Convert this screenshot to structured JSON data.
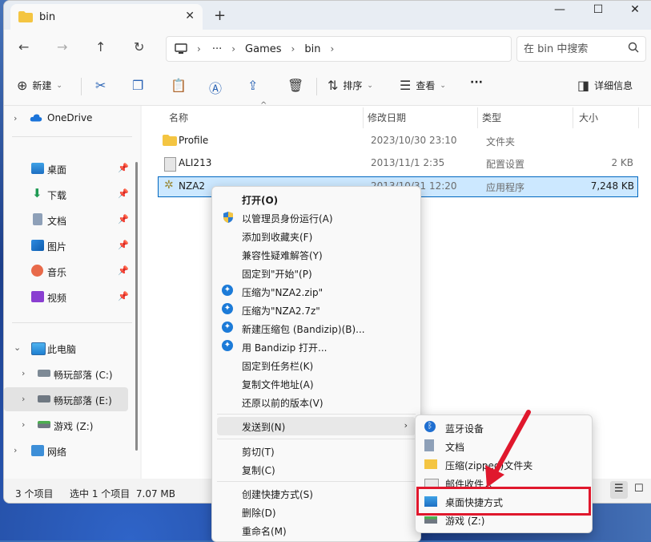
{
  "colors": {
    "accent": "#0067c0",
    "folder": "#f4c542",
    "highlight": "#e0182d",
    "selected_row": "#cce8ff"
  },
  "window": {
    "tab_title": "bin",
    "controls": {
      "minimize": "—",
      "maximize": "☐",
      "close": "✕"
    }
  },
  "nav": {
    "breadcrumb": [
      "Games",
      "bin"
    ],
    "search_placeholder": "在 bin 中搜索"
  },
  "toolbar": {
    "new_label": "新建",
    "sort_label": "排序",
    "view_label": "查看",
    "more_label": "···",
    "details_label": "详细信息"
  },
  "sidebar": {
    "items": [
      {
        "label": "OneDrive",
        "icon": "cloud-icon"
      },
      {
        "label": "桌面",
        "icon": "desktop-icon"
      },
      {
        "label": "下载",
        "icon": "download-icon"
      },
      {
        "label": "文档",
        "icon": "document-icon"
      },
      {
        "label": "图片",
        "icon": "picture-icon"
      },
      {
        "label": "音乐",
        "icon": "music-icon"
      },
      {
        "label": "视频",
        "icon": "video-icon"
      },
      {
        "label": "此电脑",
        "icon": "computer-icon"
      },
      {
        "label": "畅玩部落 (C:)",
        "icon": "drive-icon"
      },
      {
        "label": "畅玩部落 (E:)",
        "icon": "drive-icon"
      },
      {
        "label": "游戏 (Z:)",
        "icon": "drive-icon"
      },
      {
        "label": "网络",
        "icon": "network-icon"
      }
    ]
  },
  "list": {
    "columns": [
      "名称",
      "修改日期",
      "类型",
      "大小"
    ],
    "rows": [
      {
        "name": "Profile",
        "date": "2023/10/30 23:10",
        "type": "文件夹",
        "size": ""
      },
      {
        "name": "ALI213",
        "date": "2013/11/1 2:35",
        "type": "配置设置",
        "size": "2 KB"
      },
      {
        "name": "NZA2",
        "date": "2013/10/31 12:20",
        "type": "应用程序",
        "size": "7,248 KB"
      }
    ]
  },
  "status": {
    "count": "3 个项目",
    "selected": "选中 1 个项目  7.07 MB"
  },
  "context_menu": {
    "items": [
      "打开(O)",
      "以管理员身份运行(A)",
      "添加到收藏夹(F)",
      "兼容性疑难解答(Y)",
      "固定到\"开始\"(P)",
      "压缩为\"NZA2.zip\"",
      "压缩为\"NZA2.7z\"",
      "新建压缩包 (Bandizip)(B)...",
      "用 Bandizip 打开...",
      "固定到任务栏(K)",
      "复制文件地址(A)",
      "还原以前的版本(V)",
      "发送到(N)",
      "剪切(T)",
      "复制(C)",
      "创建快捷方式(S)",
      "删除(D)",
      "重命名(M)"
    ]
  },
  "send_to": {
    "items": [
      "蓝牙设备",
      "文档",
      "压缩(zipped)文件夹",
      "邮件收件人",
      "桌面快捷方式",
      "游戏 (Z:)"
    ]
  }
}
